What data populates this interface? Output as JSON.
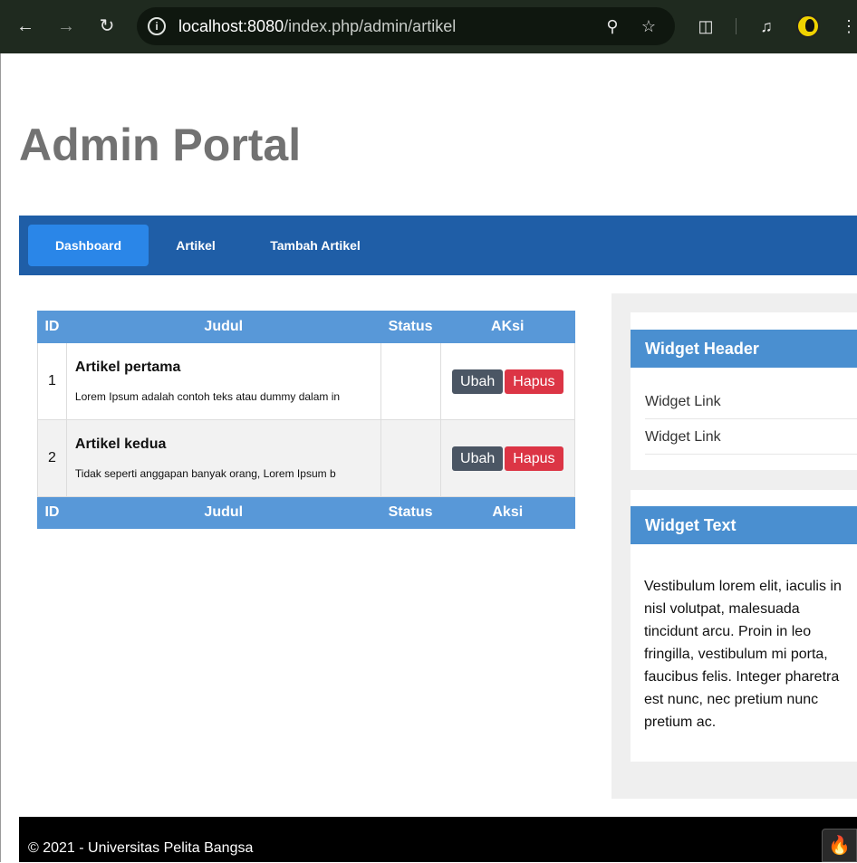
{
  "browser": {
    "url_host": "localhost:8080",
    "url_path": "/index.php/admin/artikel"
  },
  "header": {
    "title": "Admin Portal"
  },
  "nav": {
    "items": [
      "Dashboard",
      "Artikel",
      "Tambah Artikel"
    ],
    "active": "Dashboard"
  },
  "table": {
    "head": [
      "ID",
      "Judul",
      "Status",
      "AKsi"
    ],
    "foot": [
      "ID",
      "Judul",
      "Status",
      "Aksi"
    ],
    "rows": [
      {
        "id": "1",
        "title": "Artikel pertama",
        "desc": "Lorem Ipsum adalah contoh teks atau dummy dalam in",
        "status": "",
        "edit": "Ubah",
        "delete": "Hapus"
      },
      {
        "id": "2",
        "title": "Artikel kedua",
        "desc": "Tidak seperti anggapan banyak orang, Lorem Ipsum b",
        "status": "",
        "edit": "Ubah",
        "delete": "Hapus"
      }
    ]
  },
  "sidebar": {
    "widget1": {
      "header": "Widget Header",
      "links": [
        "Widget Link",
        "Widget Link"
      ]
    },
    "widget2": {
      "header": "Widget Text",
      "text": "Vestibulum lorem elit, iaculis in nisl volutpat, malesuada tincidunt arcu. Proin in leo fringilla, vestibulum mi porta, faucibus felis. Integer pharetra est nunc, nec pretium nunc pretium ac."
    }
  },
  "footer": {
    "copyright": "© 2021 - Universitas Pelita Bangsa"
  },
  "colors": {
    "nav": "#1f5ea7",
    "nav_active": "#2a86e8",
    "table_header": "#5898d8",
    "widget_header": "#4a8fd0",
    "btn_edit": "#4b5664",
    "btn_delete": "#dc3545"
  },
  "icons": [
    "back-icon",
    "forward-icon",
    "reload-icon",
    "site-info-icon",
    "zoom-icon",
    "bookmark-star-icon",
    "extensions-icon",
    "media-controls-icon",
    "profile-avatar-icon",
    "codeigniter-flame-icon"
  ]
}
